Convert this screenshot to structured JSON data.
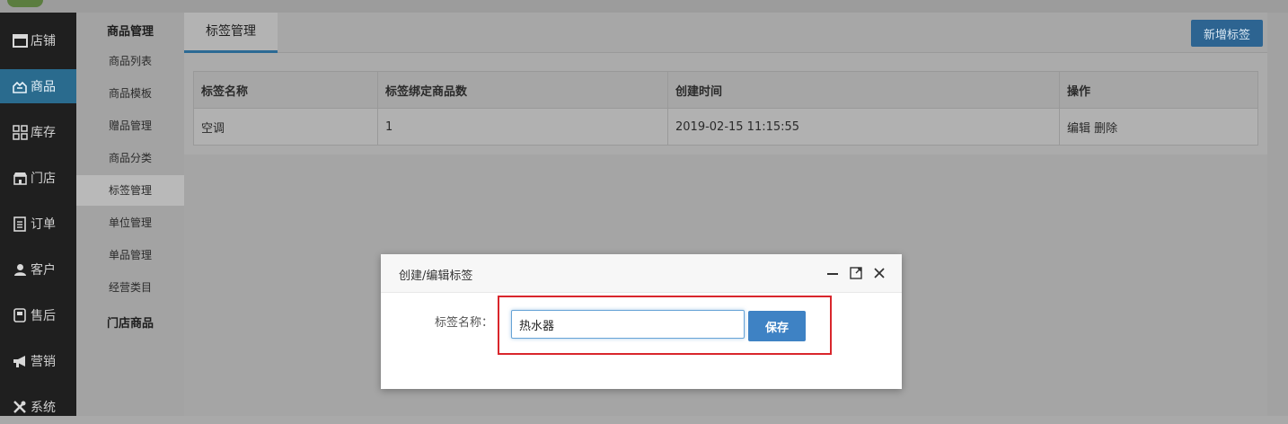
{
  "sidebar": {
    "items": [
      {
        "label": "店铺",
        "icon": "store-icon"
      },
      {
        "label": "商品",
        "icon": "goods-icon",
        "active": true
      },
      {
        "label": "库存",
        "icon": "grid-icon"
      },
      {
        "label": "门店",
        "icon": "shop-icon"
      },
      {
        "label": "订单",
        "icon": "order-icon"
      },
      {
        "label": "客户",
        "icon": "user-icon"
      },
      {
        "label": "售后",
        "icon": "service-icon"
      },
      {
        "label": "营销",
        "icon": "megaphone-icon"
      },
      {
        "label": "系统",
        "icon": "tools-icon"
      }
    ]
  },
  "submenu": {
    "header": "商品管理",
    "items": [
      "商品列表",
      "商品模板",
      "赠品管理",
      "商品分类",
      "标签管理",
      "单位管理",
      "单品管理",
      "经营类目"
    ],
    "active_index": 4,
    "footer_header": "门店商品"
  },
  "main": {
    "tab_label": "标签管理",
    "new_button": "新增标签",
    "table": {
      "headers": [
        "标签名称",
        "标签绑定商品数",
        "创建时间",
        "操作"
      ],
      "rows": [
        {
          "name": "空调",
          "count": "1",
          "created": "2019-02-15 11:15:55",
          "edit": "编辑",
          "delete": "删除"
        }
      ]
    }
  },
  "modal": {
    "title": "创建/编辑标签",
    "label": "标签名称：",
    "input_value": "热水器",
    "save_label": "保存"
  }
}
